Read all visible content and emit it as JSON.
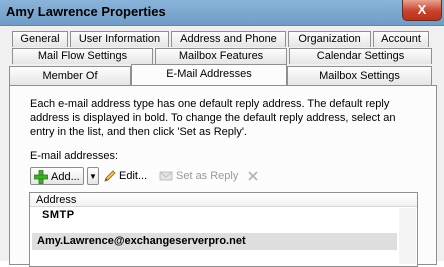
{
  "window": {
    "title": "Amy Lawrence Properties",
    "close_glyph": "X"
  },
  "tabs": {
    "row1": [
      "General",
      "User Information",
      "Address and Phone",
      "Organization",
      "Account"
    ],
    "row2": [
      "Mail Flow Settings",
      "Mailbox Features",
      "Calendar Settings"
    ],
    "row3": [
      "Member Of",
      "E-Mail Addresses",
      "Mailbox Settings"
    ],
    "active": "E-Mail Addresses"
  },
  "description": "Each e-mail address type has one default reply address. The default reply address is displayed in bold. To change the default reply address, select an entry in the list, and then click 'Set as Reply'.",
  "addresses_label": "E-mail addresses:",
  "toolbar": {
    "add_label": "Add...",
    "edit_label": "Edit...",
    "set_as_reply_label": "Set as Reply",
    "add_icon": "green-plus-icon",
    "edit_icon": "pencil-icon",
    "set_reply_icon": "mail-reply-icon",
    "remove_icon": "x-delete-icon"
  },
  "list": {
    "column_header": "Address",
    "group": "SMTP",
    "rows": [
      {
        "address": "Amy.Lawrence@exchangeserverpro.net",
        "bold": true,
        "selected": true
      }
    ]
  },
  "colors": {
    "titlebar": "#7aa6cf",
    "close_button": "#c8432b",
    "selected_row": "#dedede"
  }
}
